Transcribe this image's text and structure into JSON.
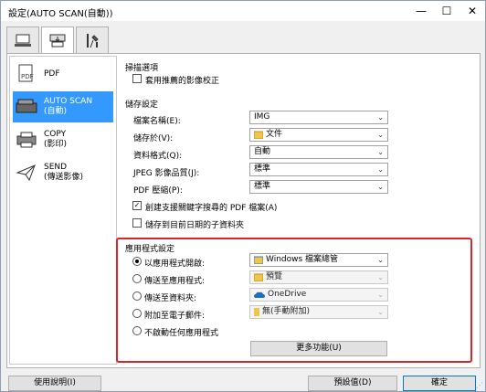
{
  "window": {
    "title": "設定(AUTO SCAN(自動))",
    "min_glyph": "—",
    "max_glyph": "☐",
    "close_glyph": "✕"
  },
  "tabs": [
    {
      "icon": "computer-scan-icon",
      "active": false
    },
    {
      "icon": "scanner-device-icon",
      "active": true
    },
    {
      "icon": "tools-icon",
      "active": false
    }
  ],
  "sidebar": {
    "items": [
      {
        "label": "PDF",
        "icon": "pdf-icon",
        "active": false
      },
      {
        "label": "AUTO SCAN\n(自動)",
        "icon": "scanner-icon",
        "active": true
      },
      {
        "label": "COPY\n(影印)",
        "icon": "printer-icon",
        "active": false
      },
      {
        "label": "SEND\n(傳送影像)",
        "icon": "send-icon",
        "active": false
      }
    ]
  },
  "scan_options": {
    "title": "掃描選項",
    "auto_correct_label": "套用推薦的影像校正",
    "auto_correct_checked": false
  },
  "save_settings": {
    "title": "儲存設定",
    "file_name_label": "檔案名稱(E):",
    "file_name_value": "IMG",
    "save_in_label": "儲存於(V):",
    "save_in_value": "文件",
    "data_format_label": "資料格式(Q):",
    "data_format_value": "自動",
    "jpeg_quality_label": "JPEG 影像品質(J):",
    "jpeg_quality_value": "標準",
    "pdf_compression_label": "PDF 壓縮(P):",
    "pdf_compression_value": "標準",
    "searchable_pdf_label": "創建支援關鍵字搜尋的 PDF 檔案(A)",
    "searchable_pdf_checked": true,
    "date_subfolder_label": "儲存到目前日期的子資料夾",
    "date_subfolder_checked": false
  },
  "app_settings": {
    "title": "應用程式設定",
    "options": [
      {
        "label": "以應用程式開啟:",
        "checked": true,
        "value": "Windows 檔案總管",
        "icon": "explorer-icon",
        "enabled": true
      },
      {
        "label": "傳送至應用程式:",
        "checked": false,
        "value": "預覽",
        "icon": "folder-icon",
        "enabled": false
      },
      {
        "label": "傳送至資料夾:",
        "checked": false,
        "value": "OneDrive",
        "icon": "cloud-icon",
        "enabled": false
      },
      {
        "label": "附加至電子郵件:",
        "checked": false,
        "value": "無(手動附加)",
        "icon": "mail-icon",
        "enabled": false
      },
      {
        "label": "不啟動任何應用程式",
        "checked": false
      }
    ],
    "more_functions_label": "更多功能(U)"
  },
  "footer": {
    "help_label": "使用說明(I)",
    "defaults_label": "預設值(D)",
    "ok_label": "確定"
  },
  "colors": {
    "accent": "#3399ff",
    "highlight_border": "#d9242b"
  }
}
